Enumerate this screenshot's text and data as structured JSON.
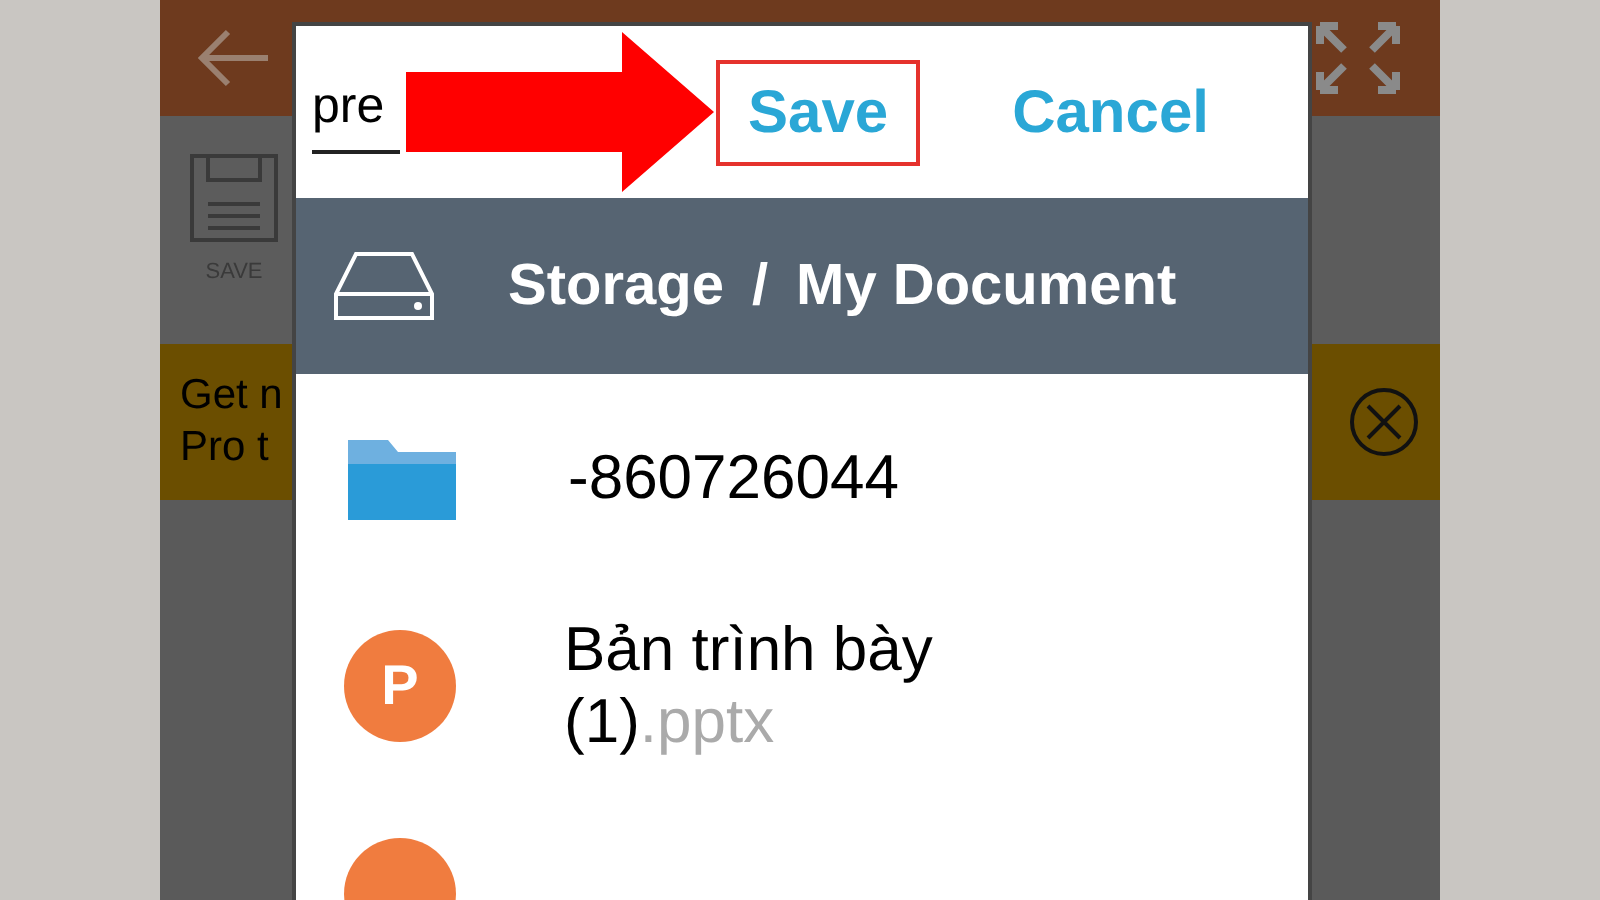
{
  "background_app": {
    "toolbar_items": [
      {
        "label": "SAVE"
      }
    ],
    "banner": {
      "lines": [
        "Get n",
        "Pro t"
      ]
    }
  },
  "dialog": {
    "filename_field": {
      "value": "pre"
    },
    "buttons": [
      {
        "label": "Save",
        "highlighted": true
      },
      {
        "label": "Cancel",
        "highlighted": false
      }
    ],
    "breadcrumb": [
      "Storage",
      "/",
      "My Document"
    ],
    "files": [
      {
        "kind": "folder",
        "name": "-860726044"
      },
      {
        "kind": "pptx",
        "icon_letter": "P",
        "name": "Bản trình bày (1)",
        "extension": ".pptx"
      },
      {
        "kind": "pptx"
      }
    ]
  }
}
